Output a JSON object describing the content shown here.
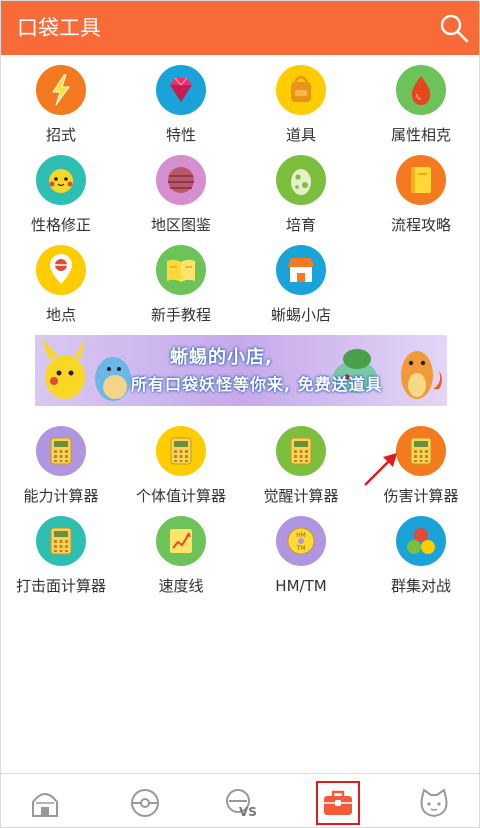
{
  "header": {
    "title": "口袋工具"
  },
  "colors": {
    "header": "#f86a37",
    "accent": "#e01b1b"
  },
  "tools_top": [
    {
      "label": "招式",
      "icon": "lightning-icon",
      "color": "#f5791f"
    },
    {
      "label": "特性",
      "icon": "gem-icon",
      "color": "#1aa3d8"
    },
    {
      "label": "道具",
      "icon": "bag-icon",
      "color": "#ffcc00"
    },
    {
      "label": "属性相克",
      "icon": "drop-icon",
      "color": "#6cc35a"
    },
    {
      "label": "性格修正",
      "icon": "face-icon",
      "color": "#2ebfb3"
    },
    {
      "label": "地区图鉴",
      "icon": "ball-icon",
      "color": "#d58fd0"
    },
    {
      "label": "培育",
      "icon": "egg-icon",
      "color": "#7cbe3e"
    },
    {
      "label": "流程攻略",
      "icon": "book-icon",
      "color": "#f5791f"
    },
    {
      "label": "地点",
      "icon": "location-pin-icon",
      "color": "#ffcc00"
    },
    {
      "label": "新手教程",
      "icon": "open-book-icon",
      "color": "#6cc35a"
    },
    {
      "label": "蜥蜴小店",
      "icon": "shop-icon",
      "color": "#1aa3d8"
    }
  ],
  "banner": {
    "line1": "蜥蜴的小店,",
    "line2": "所有口袋妖怪等你来, 免费送道具"
  },
  "tools_bottom": [
    {
      "label": "能力计算器",
      "icon": "calculator-icon",
      "color": "#b096e0"
    },
    {
      "label": "个体值计算器",
      "icon": "calculator-icon",
      "color": "#ffcc00"
    },
    {
      "label": "觉醒计算器",
      "icon": "calculator-icon",
      "color": "#7cbe3e"
    },
    {
      "label": "伤害计算器",
      "icon": "calculator-icon",
      "color": "#f5791f"
    },
    {
      "label": "打击面计算器",
      "icon": "calculator-icon",
      "color": "#2ebfb3"
    },
    {
      "label": "速度线",
      "icon": "chart-line-icon",
      "color": "#6cc35a"
    },
    {
      "label": "HM/TM",
      "icon": "disc-icon",
      "color": "#b096e0"
    },
    {
      "label": "群集对战",
      "icon": "team-icon",
      "color": "#1aa3d8"
    }
  ],
  "tabbar": {
    "items": [
      {
        "icon": "home-icon"
      },
      {
        "icon": "pokeball-icon"
      },
      {
        "icon": "versus-icon"
      },
      {
        "icon": "toolbox-icon",
        "active": true
      },
      {
        "icon": "cat-face-icon"
      }
    ]
  }
}
